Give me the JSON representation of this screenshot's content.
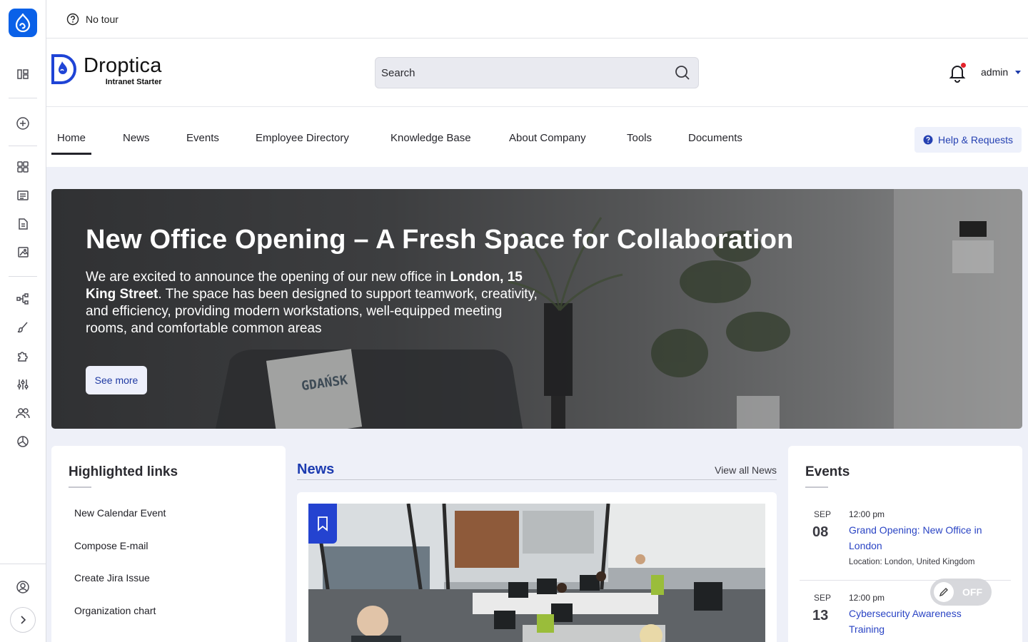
{
  "tour": {
    "label": "No tour"
  },
  "brand": {
    "name": "Droptica",
    "subtitle": "Intranet Starter"
  },
  "search": {
    "placeholder": "Search"
  },
  "user": {
    "name": "admin",
    "has_notification": true
  },
  "nav": {
    "items": [
      {
        "label": "Home",
        "active": true
      },
      {
        "label": "News"
      },
      {
        "label": "Events"
      },
      {
        "label": "Employee Directory"
      },
      {
        "label": "Knowledge Base"
      },
      {
        "label": "About Company"
      },
      {
        "label": "Tools"
      },
      {
        "label": "Documents"
      }
    ],
    "help_label": "Help & Requests"
  },
  "hero": {
    "title": "New Office Opening – A Fresh Space for Collaboration",
    "text_1": "We are excited to announce the opening of our new office in ",
    "text_bold_1": "London, 15 King Street",
    "text_2": ". The space has been designed to support teamwork, creativity, and efficiency, providing modern workstations, well-equipped meeting rooms, and comfortable common areas",
    "button": "See more",
    "poster_text": "GDAŃSK"
  },
  "highlighted_links": {
    "title": "Highlighted links",
    "items": [
      "New Calendar Event",
      "Compose E-mail",
      "Create Jira Issue",
      "Organization chart"
    ]
  },
  "news": {
    "title": "News",
    "view_all": "View all News"
  },
  "events": {
    "title": "Events",
    "items": [
      {
        "month": "SEP",
        "day": "08",
        "time": "12:00 pm",
        "title": "Grand Opening: New Office in London",
        "location": "Location: London, United Kingdom"
      },
      {
        "month": "SEP",
        "day": "13",
        "time": "12:00 pm",
        "title": "Cybersecurity Awareness Training"
      }
    ]
  },
  "toggle": {
    "label": "OFF"
  },
  "colors": {
    "accent": "#2443d0",
    "admin_brand": "#0a61e8",
    "link": "#2a44c4",
    "notification": "#e4232b"
  }
}
